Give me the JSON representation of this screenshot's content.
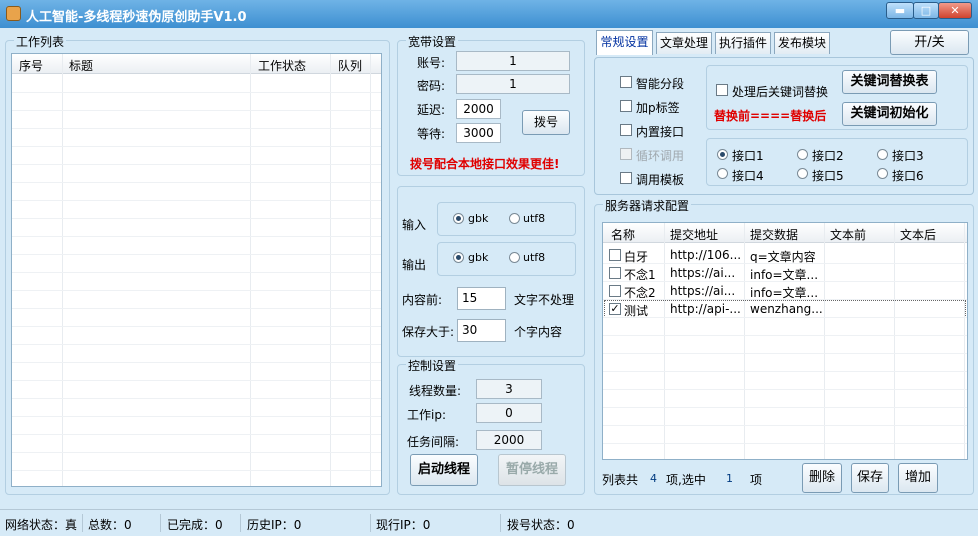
{
  "title": "人工智能-多线程秒速伪原创助手V1.0",
  "window_controls": {
    "min": "▬",
    "max": "□",
    "close": "✕"
  },
  "work_list": {
    "title": "工作列表",
    "columns": [
      "序号",
      "标题",
      "工作状态",
      "队列"
    ]
  },
  "broadband": {
    "title": "宽带设置",
    "account_label": "账号:",
    "account_value": "1",
    "password_label": "密码:",
    "password_value": "1",
    "delay_label": "延迟:",
    "delay_value": "2000",
    "wait_label": "等待:",
    "wait_value": "3000",
    "dial_button": "拨号",
    "hint": "拨号配合本地接口效果更佳!"
  },
  "encoding": {
    "input_label": "输入",
    "output_label": "输出",
    "gbk": "gbk",
    "utf8": "utf8",
    "content_before_label": "内容前:",
    "content_before_value": "15",
    "content_before_suffix": "文字不处理",
    "save_larger_label": "保存大于:",
    "save_larger_value": "30",
    "save_larger_suffix": "个字内容"
  },
  "control": {
    "title": "控制设置",
    "threads_label": "线程数量:",
    "threads_value": "3",
    "work_ip_label": "工作ip:",
    "work_ip_value": "0",
    "interval_label": "任务间隔:",
    "interval_value": "2000",
    "start_button": "启动线程",
    "pause_button": "暂停线程"
  },
  "tabs": [
    "常规设置",
    "文章处理",
    "执行插件",
    "发布模块"
  ],
  "toggle_button": "开/关",
  "general": {
    "smart_paragraph": "智能分段",
    "add_p_tag": "加p标签",
    "builtin_api": "内置接口",
    "loop_disabled": "循环调用",
    "use_template": "调用模板",
    "keyword_replace_after": "处理后关键词替换",
    "replace_hint": "替换前====替换后",
    "keyword_table_button": "关键词替换表",
    "keyword_init_button": "关键词初始化",
    "ports": [
      "接口1",
      "接口2",
      "接口3",
      "接口4",
      "接口5",
      "接口6"
    ]
  },
  "server": {
    "title": "服务器请求配置",
    "columns": [
      "名称",
      "提交地址",
      "提交数据",
      "文本前",
      "文本后"
    ],
    "rows": [
      {
        "checked": false,
        "name": "白牙",
        "url": "http://106...",
        "data": "q=文章内容",
        "before": "",
        "after": ""
      },
      {
        "checked": false,
        "name": "不念1",
        "url": "https://ai...",
        "data": "info=文章...",
        "before": "",
        "after": ""
      },
      {
        "checked": false,
        "name": "不念2",
        "url": "https://ai...",
        "data": "info=文章...",
        "before": "",
        "after": ""
      },
      {
        "checked": true,
        "name": "测试",
        "url": "http://api-...",
        "data": "wenzhang...",
        "before": "",
        "after": ""
      }
    ],
    "footer_prefix": "列表共",
    "total": "4",
    "footer_mid": "项,选中",
    "selected": "1",
    "footer_suffix": "项",
    "delete_button": "删除",
    "save_button": "保存",
    "add_button": "增加"
  },
  "status": {
    "network": "网络状态：真",
    "total": "总数：0",
    "done": "已完成：0",
    "history_ip": "历史IP：0",
    "current_ip": "现行IP：0",
    "dial_status": "拨号状态：0"
  }
}
